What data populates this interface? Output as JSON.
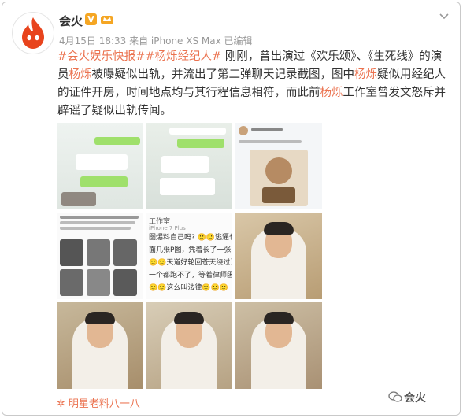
{
  "post": {
    "username": "会火",
    "verified_badge": "V",
    "meta": "4月15日 18:33 来自 iPhone XS Max   已编辑",
    "text_segments": [
      {
        "text": "#会火娱乐快报#",
        "type": "tag"
      },
      {
        "text": "#杨烁经纪人#",
        "type": "tag"
      },
      {
        "text": " 刚刚，曾出演过《欢乐颂》、《生死线》的演员",
        "type": "plain"
      },
      {
        "text": "杨烁",
        "type": "link"
      },
      {
        "text": "被曝疑似出轨，并流出了第二弹聊天记录截图，图中",
        "type": "plain"
      },
      {
        "text": "杨烁",
        "type": "link"
      },
      {
        "text": "疑似用经纪人的证件开房，时间地点均与其行程信息相符，而此前",
        "type": "plain"
      },
      {
        "text": "杨烁",
        "type": "link"
      },
      {
        "text": "工作室曾发文怒斥并辟谣了疑似出轨传闻。",
        "type": "plain"
      }
    ],
    "images": [
      {
        "icon": "chat-screenshot"
      },
      {
        "icon": "chat-screenshot"
      },
      {
        "icon": "social-post-screenshot"
      },
      {
        "icon": "weibo-post-photos"
      },
      {
        "icon": "text-post-screenshot",
        "title": "工作室",
        "sub": "iPhone 7 Plus",
        "lines": [
          "图爆料自己吗? 🙂🙂逃逼也",
          "面几张P图，凭着长了一张嘴",
          "🙂🙂天道好轮回苍天绕过谁",
          "一个都跑不了，等着律师函吧",
          "🙂🙂这么叫法律🙂🙂🙂"
        ]
      },
      {
        "icon": "actor-photo"
      },
      {
        "icon": "actor-photo"
      },
      {
        "icon": "actor-photo"
      },
      {
        "icon": "actor-photo"
      }
    ],
    "source": "明星老料八一八",
    "watermark": "会火"
  },
  "colors": {
    "accent": "#eb7350",
    "text": "#333333",
    "meta": "#999999",
    "badge": "#f5a623",
    "logo": "#e8441d"
  }
}
